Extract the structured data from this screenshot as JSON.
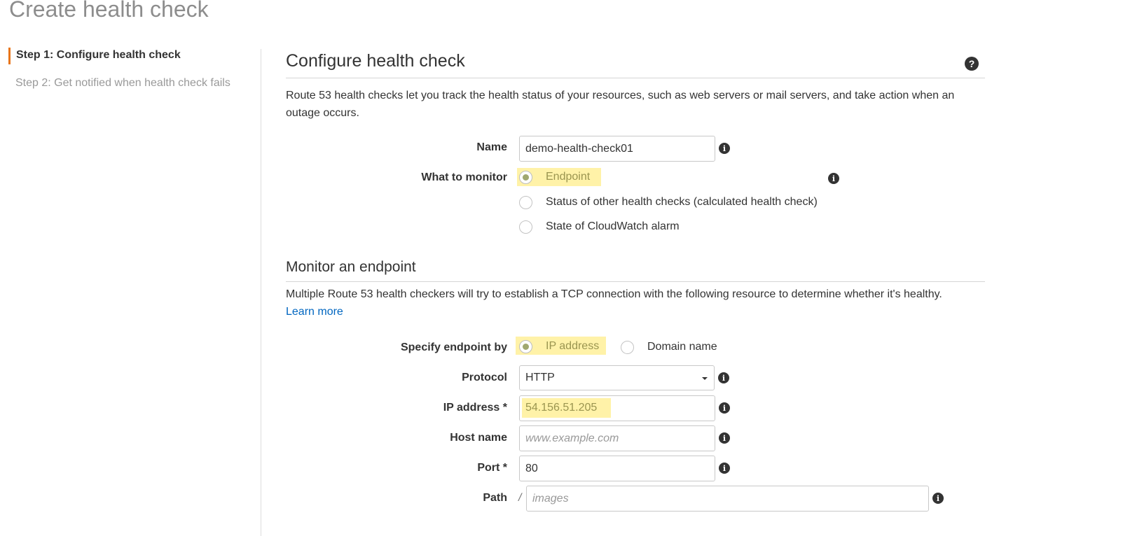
{
  "page_title": "Create health check",
  "steps": {
    "step1": "Step 1: Configure health check",
    "step2": "Step 2: Get notified when health check fails"
  },
  "configure": {
    "heading": "Configure health check",
    "description": "Route 53 health checks let you track the health status of your resources, such as web servers or mail servers, and take action when an outage occurs."
  },
  "form": {
    "name_label": "Name",
    "name_value": "demo-health-check01",
    "monitor_label": "What to monitor",
    "monitor_options": [
      "Endpoint",
      "Status of other health checks (calculated health check)",
      "State of CloudWatch alarm"
    ],
    "monitor_selected": "Endpoint"
  },
  "endpoint": {
    "heading": "Monitor an endpoint",
    "description": "Multiple Route 53 health checkers will try to establish a TCP connection with the following resource to determine whether it's healthy.",
    "learn_more": "Learn more",
    "specify_label": "Specify endpoint by",
    "specify_options": [
      "IP address",
      "Domain name"
    ],
    "specify_selected": "IP address",
    "protocol_label": "Protocol",
    "protocol_value": "HTTP",
    "ip_label": "IP address *",
    "ip_value": "54.156.51.205",
    "host_label": "Host name",
    "host_placeholder": "www.example.com",
    "port_label": "Port *",
    "port_value": "80",
    "path_label": "Path",
    "path_prefix": "/",
    "path_placeholder": "images"
  },
  "colors": {
    "accent_step": "#e8751a",
    "highlight": "#fff2a8",
    "link": "#0066c0"
  }
}
